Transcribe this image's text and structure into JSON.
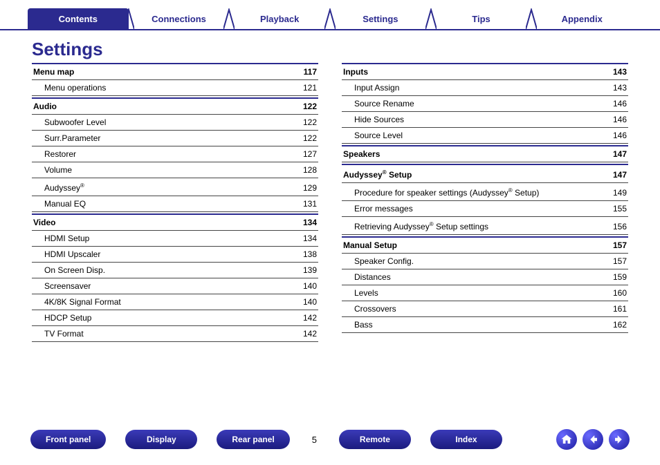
{
  "tabs": [
    "Contents",
    "Connections",
    "Playback",
    "Settings",
    "Tips",
    "Appendix"
  ],
  "active_tab": 0,
  "title": "Settings",
  "page_number": "5",
  "footer_buttons_left": [
    "Front panel",
    "Display",
    "Rear panel"
  ],
  "footer_buttons_right": [
    "Remote",
    "Index"
  ],
  "nav_icons": [
    "home-icon",
    "arrow-left-icon",
    "arrow-right-icon"
  ],
  "columns": [
    [
      {
        "heading": {
          "label": "Menu map",
          "page": "117"
        },
        "items": [
          {
            "label": "Menu operations",
            "page": "121"
          }
        ]
      },
      {
        "heading": {
          "label": "Audio",
          "page": "122"
        },
        "items": [
          {
            "label": "Subwoofer Level",
            "page": "122"
          },
          {
            "label": "Surr.Parameter",
            "page": "122"
          },
          {
            "label": "Restorer",
            "page": "127"
          },
          {
            "label": "Volume",
            "page": "128"
          },
          {
            "label": "Audyssey",
            "sup": "®",
            "page": "129"
          },
          {
            "label": "Manual EQ",
            "page": "131"
          }
        ]
      },
      {
        "heading": {
          "label": "Video",
          "page": "134"
        },
        "items": [
          {
            "label": "HDMI Setup",
            "page": "134"
          },
          {
            "label": "HDMI Upscaler",
            "page": "138"
          },
          {
            "label": "On Screen Disp.",
            "page": "139"
          },
          {
            "label": "Screensaver",
            "page": "140"
          },
          {
            "label": "4K/8K Signal Format",
            "page": "140"
          },
          {
            "label": "HDCP Setup",
            "page": "142"
          },
          {
            "label": "TV Format",
            "page": "142"
          }
        ]
      }
    ],
    [
      {
        "heading": {
          "label": "Inputs",
          "page": "143"
        },
        "items": [
          {
            "label": "Input Assign",
            "page": "143"
          },
          {
            "label": "Source Rename",
            "page": "146"
          },
          {
            "label": "Hide Sources",
            "page": "146"
          },
          {
            "label": "Source Level",
            "page": "146"
          }
        ]
      },
      {
        "heading": {
          "label": "Speakers",
          "page": "147"
        },
        "items": []
      },
      {
        "heading": {
          "label": "Audyssey",
          "sup": "®",
          "label2": " Setup",
          "page": "147"
        },
        "items": [
          {
            "label": "Procedure for speaker settings (Audyssey",
            "sup": "®",
            "label2": " Setup)",
            "page": "149"
          },
          {
            "label": "Error messages",
            "page": "155"
          },
          {
            "label": "Retrieving Audyssey",
            "sup": "®",
            "label2": " Setup settings",
            "page": "156"
          }
        ]
      },
      {
        "heading": {
          "label": "Manual Setup",
          "page": "157"
        },
        "items": [
          {
            "label": "Speaker Config.",
            "page": "157"
          },
          {
            "label": "Distances",
            "page": "159"
          },
          {
            "label": "Levels",
            "page": "160"
          },
          {
            "label": "Crossovers",
            "page": "161"
          },
          {
            "label": "Bass",
            "page": "162"
          }
        ]
      }
    ]
  ]
}
